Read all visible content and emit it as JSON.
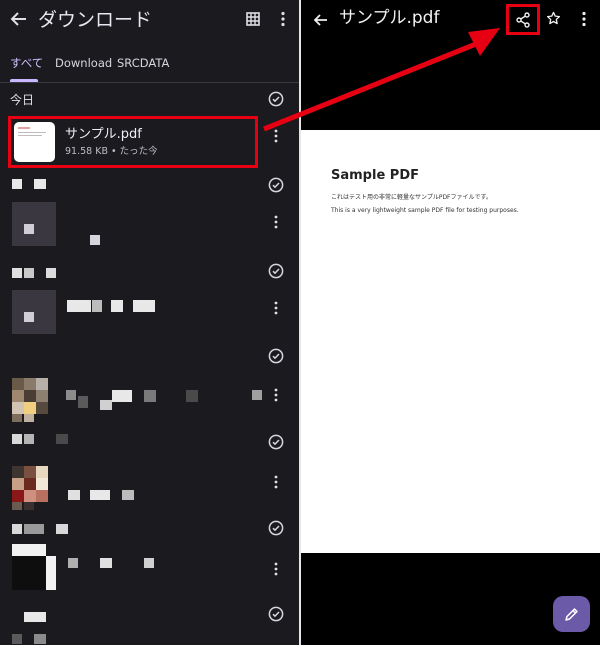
{
  "left": {
    "title": "ダウンロード",
    "tabs": [
      "すべて",
      "Download",
      "SRCDATA"
    ],
    "section": "今日",
    "file": {
      "name": "サンプル.pdf",
      "meta": "91.58 KB • たった今"
    }
  },
  "right": {
    "title": "サンプル.pdf",
    "pdf": {
      "title": "Sample PDF",
      "line1": "これはテスト用の非常に軽量なサンプルPDFファイルです。",
      "line2": "This is a very lightweight sample PDF file for testing purposes."
    }
  },
  "colors": {
    "highlight": "#e60012",
    "accent": "#c9b7ff",
    "fab": "#6b5aa8"
  },
  "icons": [
    "back-arrow-icon",
    "grid-view-icon",
    "more-vert-icon",
    "check-circle-icon",
    "share-icon",
    "star-icon",
    "edit-icon"
  ]
}
